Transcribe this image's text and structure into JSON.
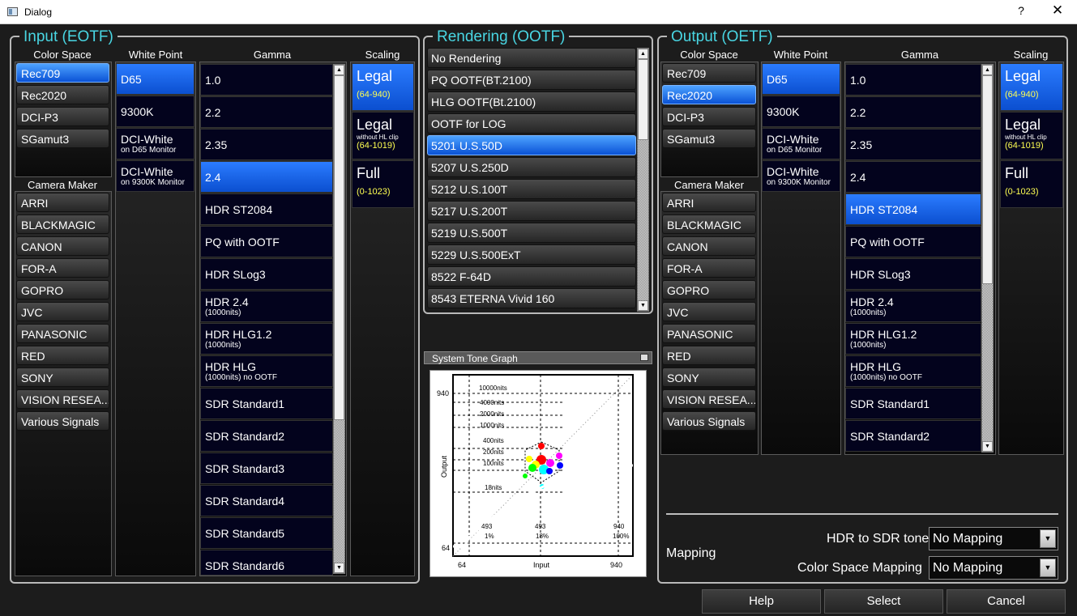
{
  "window": {
    "title": "Dialog",
    "help_glyph": "?",
    "close_glyph": "✕"
  },
  "input": {
    "title": "Input (EOTF)",
    "color_space_header": "Color Space",
    "color_spaces": [
      "Rec709",
      "Rec2020",
      "DCI-P3",
      "SGamut3"
    ],
    "color_space_selected": "Rec709",
    "camera_maker_header": "Camera Maker",
    "camera_makers": [
      "ARRI",
      "BLACKMAGIC",
      "CANON",
      "FOR-A",
      "GOPRO",
      "JVC",
      "PANASONIC",
      "RED",
      "SONY",
      "VISION RESEA...",
      "Various Signals"
    ],
    "white_point_header": "White Point",
    "white_points": [
      {
        "main": "D65",
        "sub": ""
      },
      {
        "main": "9300K",
        "sub": ""
      },
      {
        "main": "DCI-White",
        "sub": "on D65 Monitor"
      },
      {
        "main": "DCI-White",
        "sub": "on 9300K Monitor"
      }
    ],
    "white_point_selected": "D65",
    "gamma_header": "Gamma",
    "gammas": [
      {
        "main": "1.0",
        "sub": ""
      },
      {
        "main": "2.2",
        "sub": ""
      },
      {
        "main": "2.35",
        "sub": ""
      },
      {
        "main": "2.4",
        "sub": ""
      },
      {
        "main": "HDR ST2084",
        "sub": ""
      },
      {
        "main": "PQ with OOTF",
        "sub": ""
      },
      {
        "main": "HDR SLog3",
        "sub": ""
      },
      {
        "main": "HDR 2.4",
        "sub": "(1000nits)"
      },
      {
        "main": "HDR HLG1.2",
        "sub": "(1000nits)"
      },
      {
        "main": "HDR HLG",
        "sub": "(1000nits) no OOTF"
      },
      {
        "main": "SDR Standard1",
        "sub": ""
      },
      {
        "main": "SDR Standard2",
        "sub": ""
      },
      {
        "main": "SDR Standard3",
        "sub": ""
      },
      {
        "main": "SDR Standard4",
        "sub": ""
      },
      {
        "main": "SDR Standard5",
        "sub": ""
      },
      {
        "main": "SDR Standard6",
        "sub": ""
      }
    ],
    "gamma_selected": "2.4",
    "scaling_header": "Scaling",
    "scalings": [
      {
        "main": "Legal",
        "sub": "",
        "range": "(64-940)"
      },
      {
        "main": "Legal",
        "sub": "without HL clip",
        "range": "(64-1019)"
      },
      {
        "main": "Full",
        "sub": "",
        "range": "(0-1023)"
      }
    ],
    "scaling_selected": 0
  },
  "rendering": {
    "title": "Rendering (OOTF)",
    "items": [
      "No Rendering",
      "PQ OOTF(BT.2100)",
      "HLG OOTF(Bt.2100)",
      "OOTF for LOG",
      "5201 U.S.50D",
      "5207 U.S.250D",
      "5212 U.S.100T",
      "5217 U.S.200T",
      "5219 U.S.500T",
      "5229 U.S.500ExT",
      "8522 F-64D",
      "8543 ETERNA Vivid 160"
    ],
    "selected": "5201 U.S.50D"
  },
  "tone_graph": {
    "title": "System Tone Graph",
    "ylabel": "Output",
    "xlabel": "Input",
    "y_ticks": [
      "940",
      "64"
    ],
    "x_ticks": [
      "64",
      "940"
    ],
    "nits_labels": [
      "10000nits",
      "4000nits",
      "2000nits",
      "1000nits",
      "400nits",
      "200nits",
      "100nits",
      "18nits"
    ],
    "markers": [
      {
        "value": "493",
        "pct": "1%"
      },
      {
        "value": "493",
        "pct": "18%"
      },
      {
        "value": "940",
        "pct": "100%"
      }
    ]
  },
  "output": {
    "title": "Output (OETF)",
    "color_space_header": "Color Space",
    "color_spaces": [
      "Rec709",
      "Rec2020",
      "DCI-P3",
      "SGamut3"
    ],
    "color_space_selected": "Rec2020",
    "camera_maker_header": "Camera Maker",
    "camera_makers": [
      "ARRI",
      "BLACKMAGIC",
      "CANON",
      "FOR-A",
      "GOPRO",
      "JVC",
      "PANASONIC",
      "RED",
      "SONY",
      "VISION RESEA...",
      "Various Signals"
    ],
    "white_point_header": "White Point",
    "white_points": [
      {
        "main": "D65",
        "sub": ""
      },
      {
        "main": "9300K",
        "sub": ""
      },
      {
        "main": "DCI-White",
        "sub": "on D65 Monitor"
      },
      {
        "main": "DCI-White",
        "sub": "on 9300K Monitor"
      }
    ],
    "white_point_selected": "D65",
    "gamma_header": "Gamma",
    "gammas": [
      {
        "main": "1.0",
        "sub": ""
      },
      {
        "main": "2.2",
        "sub": ""
      },
      {
        "main": "2.35",
        "sub": ""
      },
      {
        "main": "2.4",
        "sub": ""
      },
      {
        "main": "HDR ST2084",
        "sub": ""
      },
      {
        "main": "PQ with OOTF",
        "sub": ""
      },
      {
        "main": "HDR SLog3",
        "sub": ""
      },
      {
        "main": "HDR 2.4",
        "sub": "(1000nits)"
      },
      {
        "main": "HDR HLG1.2",
        "sub": "(1000nits)"
      },
      {
        "main": "HDR HLG",
        "sub": "(1000nits) no OOTF"
      },
      {
        "main": "SDR Standard1",
        "sub": ""
      },
      {
        "main": "SDR Standard2",
        "sub": ""
      }
    ],
    "gamma_selected": "HDR ST2084",
    "scaling_header": "Scaling",
    "scalings": [
      {
        "main": "Legal",
        "sub": "",
        "range": "(64-940)"
      },
      {
        "main": "Legal",
        "sub": "without HL clip",
        "range": "(64-1019)"
      },
      {
        "main": "Full",
        "sub": "",
        "range": "(0-1023)"
      }
    ],
    "scaling_selected": 0,
    "mapping_label": "Mapping",
    "hdr_to_sdr_label": "HDR to SDR tone",
    "hdr_to_sdr_value": "No Mapping",
    "color_space_mapping_label": "Color Space Mapping",
    "color_space_mapping_value": "No Mapping"
  },
  "buttons": {
    "help": "Help",
    "select": "Select",
    "cancel": "Cancel"
  },
  "colors": {
    "title_cyan": "#49d6e3",
    "selected_blue": "#1e6cf0",
    "cell_bg": "#03031d",
    "range_yellow": "#ffff52"
  }
}
